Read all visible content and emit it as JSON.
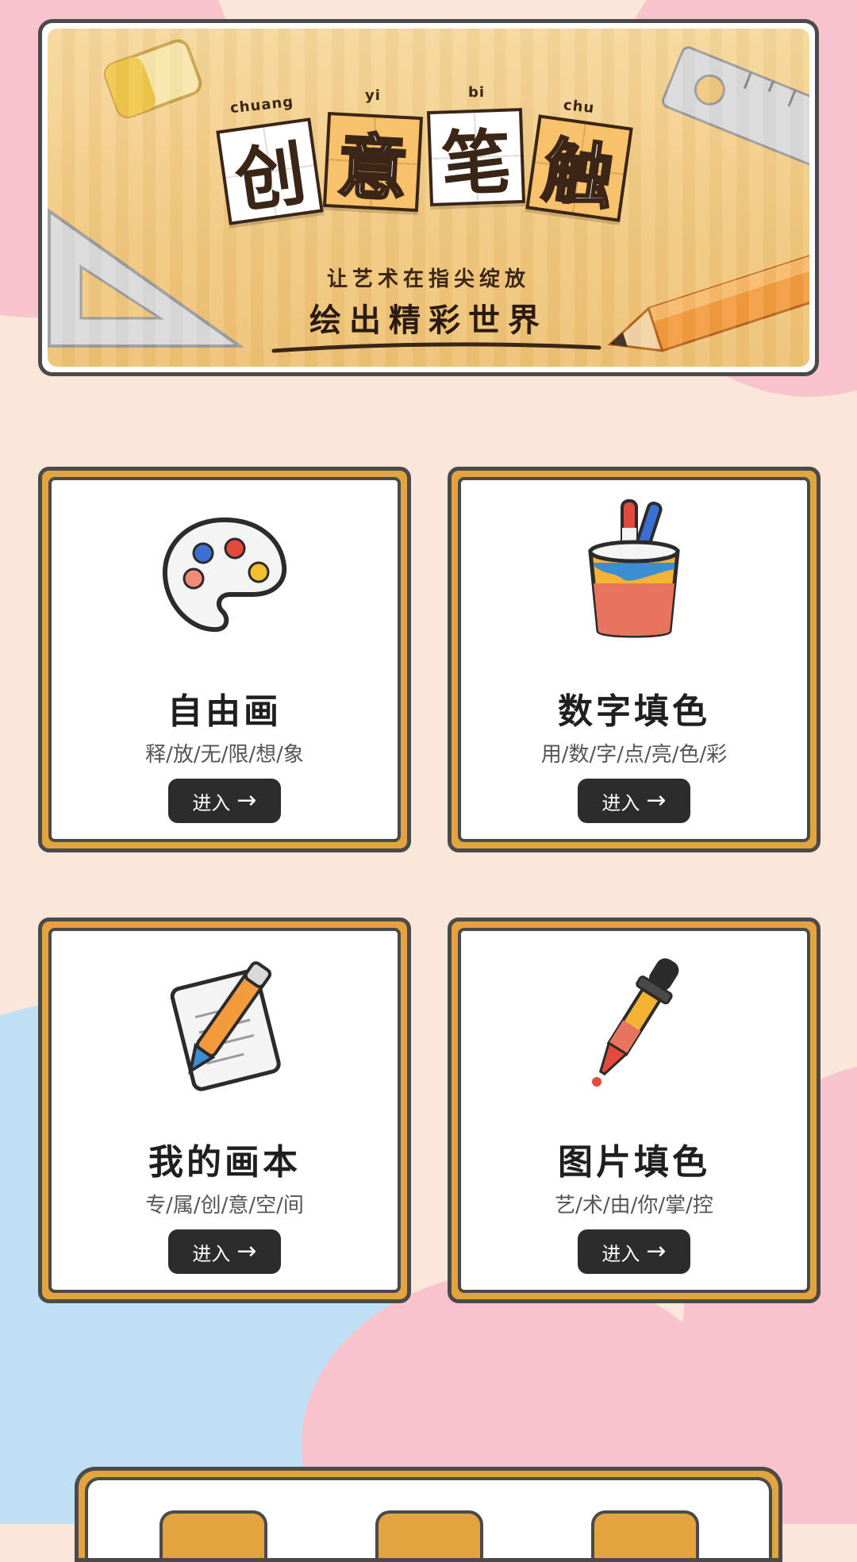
{
  "banner": {
    "tiles": [
      {
        "char": "创",
        "pinyin": "chuang"
      },
      {
        "char": "意",
        "pinyin": "yi"
      },
      {
        "char": "笔",
        "pinyin": "bi"
      },
      {
        "char": "触",
        "pinyin": "chu"
      }
    ],
    "slogan_line1": "让艺术在指尖绽放",
    "slogan_line2": "绘出精彩世界"
  },
  "cards": [
    {
      "title": "自由画",
      "subtitle": "释/放/无/限/想/象",
      "button": "进入",
      "icon": "palette-icon"
    },
    {
      "title": "数字填色",
      "subtitle": "用/数/字/点/亮/色/彩",
      "button": "进入",
      "icon": "paint-bucket-icon"
    },
    {
      "title": "我的画本",
      "subtitle": "专/属/创/意/空/间",
      "button": "进入",
      "icon": "sketchbook-pencil-icon"
    },
    {
      "title": "图片填色",
      "subtitle": "艺/术/由/你/掌/控",
      "button": "进入",
      "icon": "dropper-icon"
    }
  ],
  "colors": {
    "background": "#fbe6da",
    "card_frame": "#e3a33f",
    "button_bg": "#2c2c2c",
    "banner_bg": "#f6d79a",
    "accent_pink": "#f8c3cc",
    "accent_blue": "#bfdff5"
  }
}
